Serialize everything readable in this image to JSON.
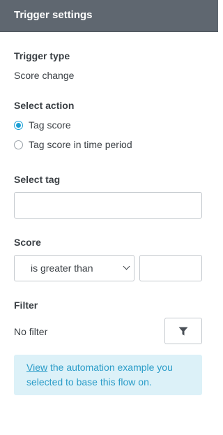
{
  "header": {
    "title": "Trigger settings"
  },
  "trigger_type": {
    "label": "Trigger type",
    "value": "Score change"
  },
  "select_action": {
    "label": "Select action",
    "options": [
      {
        "label": "Tag score",
        "checked": true
      },
      {
        "label": "Tag score in time period",
        "checked": false
      }
    ]
  },
  "select_tag": {
    "label": "Select tag",
    "value": "",
    "placeholder": ""
  },
  "score": {
    "label": "Score",
    "operator": "is greater than",
    "value": ""
  },
  "filter": {
    "label": "Filter",
    "value": "No filter",
    "button_icon": "filter-icon"
  },
  "info": {
    "link_text": "View",
    "text": " the automation example you selected to base this flow on."
  },
  "colors": {
    "header_bg": "#5f6770",
    "accent": "#1a9fd6",
    "info_bg": "#dcf1f8",
    "info_text": "#2a9cc8"
  }
}
